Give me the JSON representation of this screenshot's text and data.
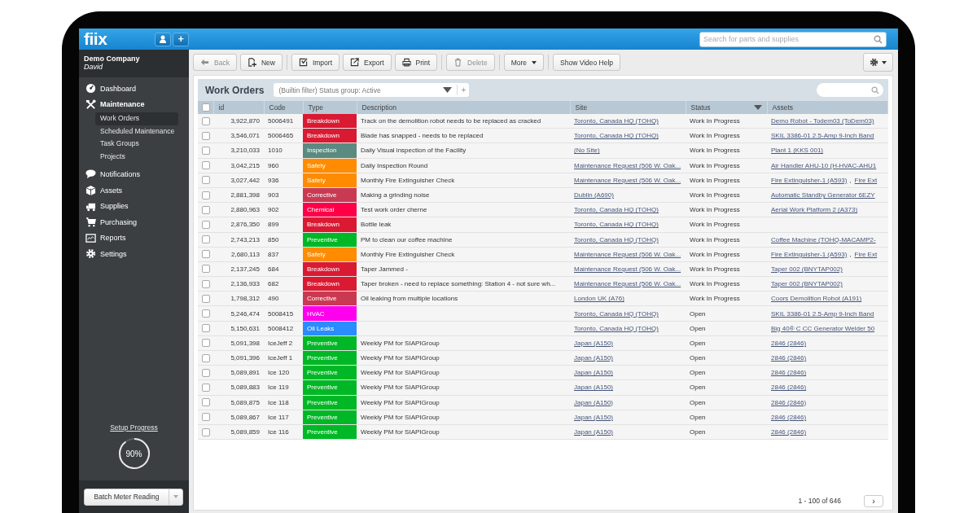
{
  "app_bar": {
    "logo": "fiix",
    "add": "+",
    "search": {
      "placeholder": "Search for parts and supplies"
    }
  },
  "account": {
    "company": "Demo Company",
    "user": "David"
  },
  "sidebar": {
    "items": [
      {
        "label": "Dashboard",
        "selected": false
      },
      {
        "label": "Maintenance",
        "selected": true,
        "expanded": true,
        "children": [
          {
            "label": "Work Orders",
            "selected": true
          },
          {
            "label": "Scheduled Maintenance",
            "selected": false
          },
          {
            "label": "Task Groups",
            "selected": false
          },
          {
            "label": "Projects",
            "selected": false
          }
        ]
      },
      {
        "label": "Notifications",
        "selected": false
      },
      {
        "label": "Assets",
        "selected": false
      },
      {
        "label": "Supplies",
        "selected": false
      },
      {
        "label": "Purchasing",
        "selected": false
      },
      {
        "label": "Reports",
        "selected": false
      },
      {
        "label": "Settings",
        "selected": false
      }
    ]
  },
  "setup_progress": {
    "link": "Setup Progress",
    "reading": "90%",
    "level": 0.9
  },
  "batch_button": {
    "label": "Batch Meter Reading"
  },
  "toolbar": {
    "groups": [
      [
        {
          "label": "Back",
          "disabled": true
        },
        {
          "label": "New",
          "disabled": false
        }
      ],
      [
        {
          "label": "Import",
          "disabled": false
        },
        {
          "label": "Export",
          "disabled": false
        },
        {
          "label": "Print",
          "disabled": false
        }
      ],
      [
        {
          "label": "Delete",
          "disabled": true
        }
      ],
      [
        {
          "label": "More",
          "disabled": false
        }
      ],
      [
        {
          "label": "Show Video Help",
          "disabled": false
        }
      ]
    ]
  },
  "panel": {
    "title": "Work Orders",
    "filter": "(Builtin filter) Status group: Active",
    "filter_add": "+",
    "table": {
      "columns": [
        "id",
        "Code",
        "Type",
        "Description",
        "Site",
        "Status",
        "Assets"
      ],
      "all_checked": false,
      "rows": [
        {
          "checked": false,
          "id": "3,922,870",
          "code": "5006491",
          "type": {
            "label": "Breakdown",
            "color": "#da1a32"
          },
          "description": "Track on the demolition robot needs to be replaced as cracked",
          "site": "Toronto, Canada HQ (TOHQ)",
          "status": "Work In Progress",
          "assets": [
            {
              "label": "Demo Robot - Todem03 (ToDem03)",
              "link": true
            }
          ]
        },
        {
          "checked": false,
          "id": "3,546,071",
          "code": "5006465",
          "type": {
            "label": "Breakdown",
            "color": "#da1a32"
          },
          "description": "Blade has snapped - needs to be replaced",
          "site": "Toronto, Canada HQ (TOHQ)",
          "status": "Work In Progress",
          "assets": [
            {
              "label": "SKIL 3386-01 2.5-Amp 9-Inch Band",
              "link": true
            }
          ]
        },
        {
          "checked": false,
          "id": "3,210,033",
          "code": "1010",
          "type": {
            "label": "Inspection",
            "color": "#5a8a80"
          },
          "description": "Daily Visual inspection of the Facility",
          "site": "(No Site)",
          "status": "Work In Progress",
          "assets": [
            {
              "label": "Plant 1 (KKS 001)",
              "link": true
            }
          ]
        },
        {
          "checked": false,
          "id": "3,042,215",
          "code": "960",
          "type": {
            "label": "Safety",
            "color": "#ff8c00"
          },
          "description": "Daily Inspection Round",
          "site": "Maintenance Request (506 W. Oak...",
          "status": "Work In Progress",
          "assets": [
            {
              "label": "Air Handler AHU-10 (H-HVAC-AHU1",
              "link": true
            }
          ]
        },
        {
          "checked": false,
          "id": "3,027,442",
          "code": "936",
          "type": {
            "label": "Safety",
            "color": "#ff8c00"
          },
          "description": "Monthly Fire Extinguisher Check",
          "site": "Maintenance Request (506 W. Oak...",
          "status": "Work In Progress",
          "assets": [
            {
              "label": "Fire Extinguisher-1 (A593)",
              "link": true
            },
            {
              "label": ",",
              "link": false
            },
            {
              "label": "Fire Ext",
              "link": true
            }
          ]
        },
        {
          "checked": false,
          "id": "2,881,398",
          "code": "903",
          "type": {
            "label": "Corrective",
            "color": "#c93a52"
          },
          "description": "Making a grinding noise",
          "site": "Dublin (A690)",
          "status": "Work In Progress",
          "assets": [
            {
              "label": "Automatic Standby Generator 6EZY",
              "link": true
            }
          ]
        },
        {
          "checked": false,
          "id": "2,880,963",
          "code": "902",
          "type": {
            "label": "Chemical",
            "color": "#ff0048"
          },
          "description": "Test work order cherne",
          "site": "Toronto, Canada HQ (TOHQ)",
          "status": "Work In Progress",
          "assets": [
            {
              "label": "Aerial Work Platform 2 (A373)",
              "link": true
            }
          ]
        },
        {
          "checked": false,
          "id": "2,876,350",
          "code": "899",
          "type": {
            "label": "Breakdown",
            "color": "#da1a32"
          },
          "description": "Bottle leak",
          "site": "Toronto, Canada HQ (TOHQ)",
          "status": "Work In Progress",
          "assets": []
        },
        {
          "checked": false,
          "id": "2,743,213",
          "code": "850",
          "type": {
            "label": "Preventive",
            "color": "#00b825"
          },
          "description": "PM to clean our coffee machine",
          "site": "Toronto, Canada HQ (TOHQ)",
          "status": "Work In Progress",
          "assets": [
            {
              "label": "Coffee Machine (TOHQ-MACAMP2-",
              "link": true
            }
          ]
        },
        {
          "checked": false,
          "id": "2,680,113",
          "code": "837",
          "type": {
            "label": "Safety",
            "color": "#ff8c00"
          },
          "description": "Monthly Fire Extinguisher Check",
          "site": "Maintenance Request (506 W. Oak...",
          "status": "Work In Progress",
          "assets": [
            {
              "label": "Fire Extinguisher-1 (A593)",
              "link": true
            },
            {
              "label": ",",
              "link": false
            },
            {
              "label": "Fire Ext",
              "link": true
            }
          ]
        },
        {
          "checked": false,
          "id": "2,137,245",
          "code": "684",
          "type": {
            "label": "Breakdown",
            "color": "#da1a32"
          },
          "description": "Taper Jammed -",
          "site": "Maintenance Request (506 W. Oak...",
          "status": "Work In Progress",
          "assets": [
            {
              "label": "Taper 002 (BNYTAP002)",
              "link": true
            }
          ]
        },
        {
          "checked": false,
          "id": "2,136,933",
          "code": "682",
          "type": {
            "label": "Breakdown",
            "color": "#da1a32"
          },
          "description": "Taper broken - need to replace something: Station 4 - not sure wh...",
          "site": "Maintenance Request (506 W. Oak...",
          "status": "Work In Progress",
          "assets": [
            {
              "label": "Taper 002 (BNYTAP002)",
              "link": true
            }
          ]
        },
        {
          "checked": false,
          "id": "1,798,312",
          "code": "490",
          "type": {
            "label": "Corrective",
            "color": "#c93a52"
          },
          "description": "Oil leaking from multiple locations",
          "site": "London UK (A76)",
          "status": "Work In Progress",
          "assets": [
            {
              "label": "Coors Demolition Robot (A191)",
              "link": true
            }
          ]
        },
        {
          "checked": false,
          "id": "5,246,474",
          "code": "5008415",
          "type": {
            "label": "HVAC",
            "color": "#ff00ee"
          },
          "description": "",
          "site": "Toronto, Canada HQ (TOHQ)",
          "status": "Open",
          "assets": [
            {
              "label": "SKIL 3386-01 2.5-Amp 9-Inch Band",
              "link": true
            }
          ]
        },
        {
          "checked": false,
          "id": "5,150,631",
          "code": "5008412",
          "type": {
            "label": "Oil Leaks",
            "color": "#2a8cff"
          },
          "description": "",
          "site": "Toronto, Canada HQ (TOHQ)",
          "status": "Open",
          "assets": [
            {
              "label": "Big 40® C CC Generator Welder 50",
              "link": true
            }
          ]
        },
        {
          "checked": false,
          "id": "5,091,398",
          "code": "IceJeff 2",
          "type": {
            "label": "Preventive",
            "color": "#00b825"
          },
          "description": "Weekly PM for SIAPIGroup",
          "site": "Japan (A150)",
          "status": "Open",
          "assets": [
            {
              "label": "2846 (2846)",
              "link": true
            }
          ]
        },
        {
          "checked": false,
          "id": "5,091,396",
          "code": "IceJeff 1",
          "type": {
            "label": "Preventive",
            "color": "#00b825"
          },
          "description": "Weekly PM for SIAPIGroup",
          "site": "Japan (A150)",
          "status": "Open",
          "assets": [
            {
              "label": "2846 (2846)",
              "link": true
            }
          ]
        },
        {
          "checked": false,
          "id": "5,089,891",
          "code": "Ice 120",
          "type": {
            "label": "Preventive",
            "color": "#00b825"
          },
          "description": "Weekly PM for SIAPIGroup",
          "site": "Japan (A150)",
          "status": "Open",
          "assets": [
            {
              "label": "2846 (2846)",
              "link": true
            }
          ]
        },
        {
          "checked": false,
          "id": "5,089,883",
          "code": "Ice 119",
          "type": {
            "label": "Preventive",
            "color": "#00b825"
          },
          "description": "Weekly PM for SIAPIGroup",
          "site": "Japan (A150)",
          "status": "Open",
          "assets": [
            {
              "label": "2846 (2846)",
              "link": true
            }
          ]
        },
        {
          "checked": false,
          "id": "5,089,875",
          "code": "Ice 118",
          "type": {
            "label": "Preventive",
            "color": "#00b825"
          },
          "description": "Weekly PM for SIAPIGroup",
          "site": "Japan (A150)",
          "status": "Open",
          "assets": [
            {
              "label": "2846 (2846)",
              "link": true
            }
          ]
        },
        {
          "checked": false,
          "id": "5,089,867",
          "code": "Ice 117",
          "type": {
            "label": "Preventive",
            "color": "#00b825"
          },
          "description": "Weekly PM for SIAPIGroup",
          "site": "Japan (A150)",
          "status": "Open",
          "assets": [
            {
              "label": "2846 (2846)",
              "link": true
            }
          ]
        },
        {
          "checked": false,
          "id": "5,089,859",
          "code": "Ice 116",
          "type": {
            "label": "Preventive",
            "color": "#00b825"
          },
          "description": "Weekly PM for SIAPIGroup",
          "site": "Japan (A150)",
          "status": "Open",
          "assets": [
            {
              "label": "2846 (2846)",
              "link": true
            }
          ]
        }
      ]
    },
    "pagination": {
      "range": "1 - 100 of 646",
      "next": "›"
    }
  }
}
